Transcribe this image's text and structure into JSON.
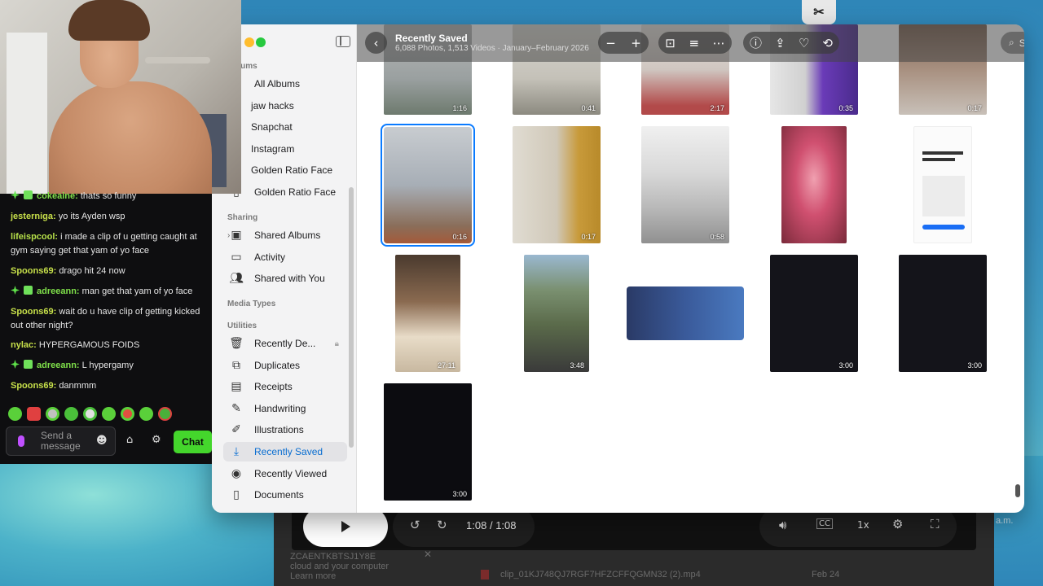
{
  "top_app_icon": "capcut-icon",
  "photos": {
    "toolbar": {
      "title": "Recently Saved",
      "subtitle": "6,088 Photos, 1,513 Videos · January–February 2026",
      "search_placeholder": "Search"
    },
    "sidebar": {
      "albums_header": "Albums",
      "albums": [
        {
          "label": "All Albums",
          "icon": "albums-icon"
        },
        {
          "label": "jaw hacks",
          "thumb": "#8c7a6a"
        },
        {
          "label": "Snapchat",
          "thumb": "#3a2a22"
        },
        {
          "label": "Instagram",
          "thumb": "#b08060"
        },
        {
          "label": "Golden Ratio Face",
          "thumb": "#6a4e3e"
        },
        {
          "label": "Golden Ratio Face",
          "icon": "document-icon"
        }
      ],
      "sharing_header": "Sharing",
      "sharing": [
        {
          "label": "Shared Albums",
          "icon": "shared-albums-icon"
        },
        {
          "label": "Activity",
          "icon": "activity-icon"
        },
        {
          "label": "Shared with You",
          "icon": "people-icon"
        }
      ],
      "media_types_header": "Media Types",
      "utilities_header": "Utilities",
      "utilities": [
        {
          "label": "Recently De...",
          "icon": "trash-icon"
        },
        {
          "label": "Duplicates",
          "icon": "duplicates-icon"
        },
        {
          "label": "Receipts",
          "icon": "receipt-icon"
        },
        {
          "label": "Handwriting",
          "icon": "pencil-icon"
        },
        {
          "label": "Illustrations",
          "icon": "illustration-icon"
        },
        {
          "label": "Recently Saved",
          "icon": "download-icon"
        },
        {
          "label": "Recently Viewed",
          "icon": "eye-icon"
        },
        {
          "label": "Documents",
          "icon": "document-icon"
        }
      ]
    },
    "grid_durations": [
      "1:16",
      "0:41",
      "2:17",
      "0:35",
      "0:17",
      "0:16",
      "0:17",
      "0:58",
      "27:11",
      "3:48",
      "3:00",
      "3:00",
      "3:00"
    ]
  },
  "chat": {
    "messages": [
      {
        "user": "cokeaine",
        "text": "thats so funny",
        "color": "#7fe04a",
        "badges": true
      },
      {
        "user": "jesterniga",
        "text": "yo its Ayden wsp",
        "color": "#c8e04a",
        "badges": false
      },
      {
        "user": "lifeispcool",
        "text": "i made a clip of u getting caught at gym saying get that yam of yo face",
        "color": "#b6e04a",
        "badges": false
      },
      {
        "user": "Spoons69",
        "text": "drago hit 24 now",
        "color": "#c7e04a",
        "badges": false
      },
      {
        "user": "adreeann",
        "text": "man get that yam of yo face",
        "color": "#7fe04a",
        "badges": true
      },
      {
        "user": "Spoons69",
        "text": "wait do u have clip of getting kicked out other night?",
        "color": "#c7e04a",
        "badges": false
      },
      {
        "user": "nylac",
        "text": "HYPERGAMOUS FOIDS",
        "color": "#c7e04a",
        "badges": false
      },
      {
        "user": "adreeann",
        "text": "L hypergamy",
        "color": "#7fe04a",
        "badges": true
      },
      {
        "user": "Spoons69",
        "text": "danmmm",
        "color": "#c7e04a",
        "badges": false
      }
    ],
    "input_placeholder_line1": "Send a",
    "input_placeholder_line2": "message",
    "chat_button": "Chat"
  },
  "player": {
    "time_current": "1:08",
    "time_sep": "/",
    "time_total": "1:08",
    "speed": "1x",
    "footer_line1": "ZCAENTKBTSJ1Y8E",
    "footer_line2": "cloud and your computer",
    "footer_line3": "Learn more",
    "filename": "clip_01KJ748QJ7RGF7HFZCFFQGMN32 (2).mp4",
    "filedate": "Feb 24",
    "side_text": "a.m."
  }
}
